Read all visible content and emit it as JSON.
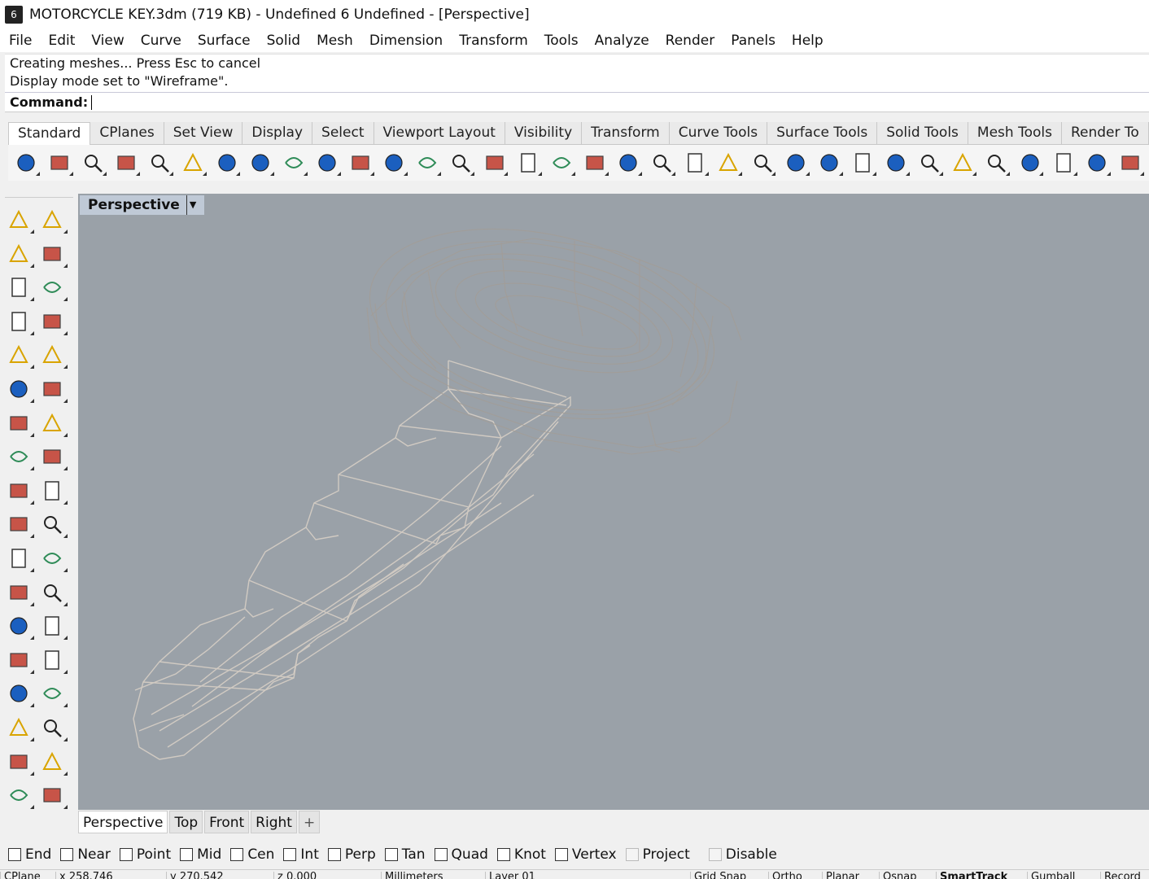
{
  "window": {
    "title": "MOTORCYCLE KEY.3dm (719 KB) - Undefined 6 Undefined - [Perspective]",
    "logo": "rhino-logo-icon"
  },
  "menu": [
    "File",
    "Edit",
    "View",
    "Curve",
    "Surface",
    "Solid",
    "Mesh",
    "Dimension",
    "Transform",
    "Tools",
    "Analyze",
    "Render",
    "Panels",
    "Help"
  ],
  "command": {
    "history": [
      "Creating meshes... Press Esc to cancel",
      "Display mode set to \"Wireframe\"."
    ],
    "prompt_label": "Command:",
    "value": ""
  },
  "toolbar_tabs": [
    "Standard",
    "CPlanes",
    "Set View",
    "Display",
    "Select",
    "Viewport Layout",
    "Visibility",
    "Transform",
    "Curve Tools",
    "Surface Tools",
    "Solid Tools",
    "Mesh Tools",
    "Render To"
  ],
  "active_toolbar_tab": "Standard",
  "toolbar_icons": [
    "new-file-icon",
    "open-folder-icon",
    "save-icon",
    "print-icon",
    "import-icon",
    "cut-icon",
    "copy-icon",
    "paste-icon",
    "undo-icon",
    "pan-hand-icon",
    "rotate-view-icon",
    "zoom-icon",
    "zoom-window-icon",
    "zoom-extents-icon",
    "zoom-selected-icon",
    "undo-view-icon",
    "four-viewports-icon",
    "car-options-icon",
    "grid-options-icon",
    "cplane-icon",
    "object-snap-icon",
    "light-icon",
    "lock-icon",
    "shield-icon",
    "color-wheel-icon",
    "wireframe-sphere-icon",
    "shaded-sphere-icon",
    "rendered-sphere-icon",
    "blue-sphere-icon",
    "render-flag-icon",
    "settings-gear-icon",
    "dimension-icon",
    "globe-icon",
    "help-icon"
  ],
  "left_toolbar_icons": [
    [
      "select-arrow-icon",
      "point-icon"
    ],
    [
      "polyline-icon",
      "curve-icon"
    ],
    [
      "circle-icon",
      "ellipse-icon"
    ],
    [
      "polygon-icon",
      "rectangle-icon"
    ],
    [
      "hexagon-icon",
      "fillet-curve-icon"
    ],
    [
      "surface-points-icon",
      "surface-edge-icon"
    ],
    [
      "box-solid-icon",
      "spheres-icon"
    ],
    [
      "cylinder-icon",
      "mesh-icon"
    ],
    [
      "gear-explode-icon",
      "lightning-icon"
    ],
    [
      "extrude-icon",
      "extrude-alt-icon"
    ],
    [
      "boolean-union-icon",
      "split-icon"
    ],
    [
      "offset-curve-icon",
      "dashed-curve-icon"
    ],
    [
      "text-icon",
      "scale-icon"
    ],
    [
      "array-icon",
      "edit-shape-icon"
    ],
    [
      "cube-shade-icon",
      "hatch-icon"
    ],
    [
      "grid-array-icon",
      "group-icon"
    ],
    [
      "mirror-icon",
      "check-icon"
    ],
    [
      "shapes-icon",
      "dimension-tool-icon"
    ]
  ],
  "viewport": {
    "title": "Perspective",
    "dropdown_icon": "dropdown-caret-icon"
  },
  "viewport_tabs": [
    "Perspective",
    "Top",
    "Front",
    "Right"
  ],
  "active_viewport_tab": "Perspective",
  "osnaps": [
    {
      "label": "End",
      "checked": false,
      "enabled": true
    },
    {
      "label": "Near",
      "checked": false,
      "enabled": true
    },
    {
      "label": "Point",
      "checked": false,
      "enabled": true
    },
    {
      "label": "Mid",
      "checked": false,
      "enabled": true
    },
    {
      "label": "Cen",
      "checked": false,
      "enabled": true
    },
    {
      "label": "Int",
      "checked": false,
      "enabled": true
    },
    {
      "label": "Perp",
      "checked": false,
      "enabled": true
    },
    {
      "label": "Tan",
      "checked": false,
      "enabled": true
    },
    {
      "label": "Quad",
      "checked": false,
      "enabled": true
    },
    {
      "label": "Knot",
      "checked": false,
      "enabled": true
    },
    {
      "label": "Vertex",
      "checked": false,
      "enabled": true
    },
    {
      "label": "Project",
      "checked": false,
      "enabled": false
    },
    {
      "label": "Disable",
      "checked": false,
      "enabled": false
    }
  ],
  "statusbar": [
    "CPlane",
    "x 258.746",
    "y 270.542",
    "z 0.000",
    "Millimeters",
    "Layer 01",
    "Grid Snap",
    "Ortho",
    "Planar",
    "Osnap",
    "SmartTrack",
    "Gumball",
    "Record"
  ],
  "colors": {
    "viewport_bg": "#9aa1a8",
    "wireframe": "#d2cbc2",
    "active_title": "#bfc9d6",
    "layer_swatch": "#000000"
  }
}
